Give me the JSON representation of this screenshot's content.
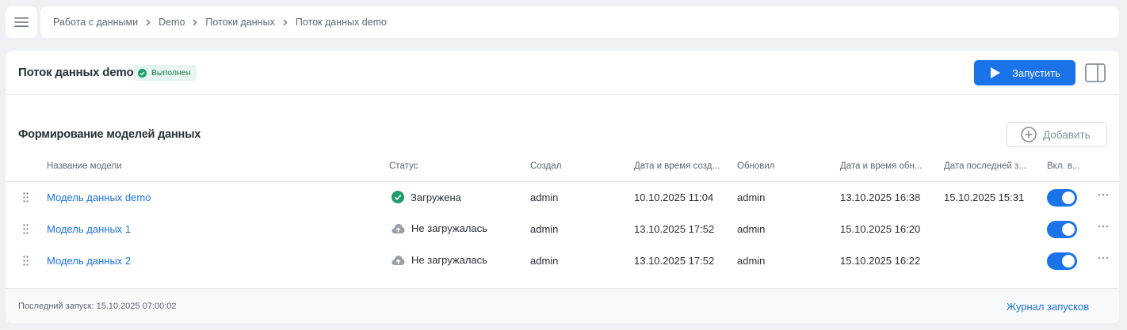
{
  "breadcrumb": [
    "Работа с данными",
    "Demo",
    "Потоки данных",
    "Поток данных demo"
  ],
  "flow": {
    "title": "Поток данных demo",
    "status_badge": "Выполнен",
    "run_label": "Запустить"
  },
  "section": {
    "title": "Формирование моделей данных",
    "add_label": "Добавить"
  },
  "table": {
    "columns": [
      "Название модели",
      "Статус",
      "Создал",
      "Дата и время созд...",
      "Обновил",
      "Дата и время обн...",
      "Дата последней з...",
      "Вкл. в..."
    ],
    "rows": [
      {
        "name": "Модель данных demo",
        "status": "Загружена",
        "status_icon": "check-circle-icon",
        "created_by": "admin",
        "created_at": "10.10.2025 11:04",
        "updated_by": "admin",
        "updated_at": "13.10.2025 16:38",
        "last_load": "15.10.2025 15:31",
        "enabled": true
      },
      {
        "name": "Модель данных 1",
        "status": "Не загружалась",
        "status_icon": "cloud-upload-icon",
        "created_by": "admin",
        "created_at": "13.10.2025 17:52",
        "updated_by": "admin",
        "updated_at": "15.10.2025 16:20",
        "last_load": "",
        "enabled": true
      },
      {
        "name": "Модель данных 2",
        "status": "Не загружалась",
        "status_icon": "cloud-upload-icon",
        "created_by": "admin",
        "created_at": "13.10.2025 17:52",
        "updated_by": "admin",
        "updated_at": "15.10.2025 16:22",
        "last_load": "",
        "enabled": true
      }
    ]
  },
  "footer": {
    "last_run": "Последний запуск: 15.10.2025 07:00:02",
    "journal_link": "Журнал запусков"
  },
  "colors": {
    "accent": "#1a73e8",
    "success": "#1e9e6a",
    "muted_icon": "#9aa0a8"
  }
}
